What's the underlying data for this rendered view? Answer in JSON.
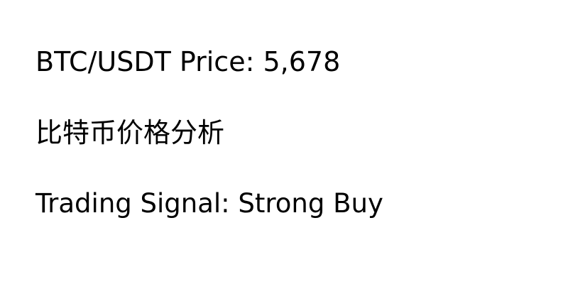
{
  "price": {
    "label": "BTC/USDT Price: 5,678"
  },
  "analysis": {
    "title": "比特币价格分析"
  },
  "signal": {
    "label": "Trading Signal: Strong Buy"
  },
  "colors": {
    "background": "#ffffff",
    "text": "#000000"
  }
}
